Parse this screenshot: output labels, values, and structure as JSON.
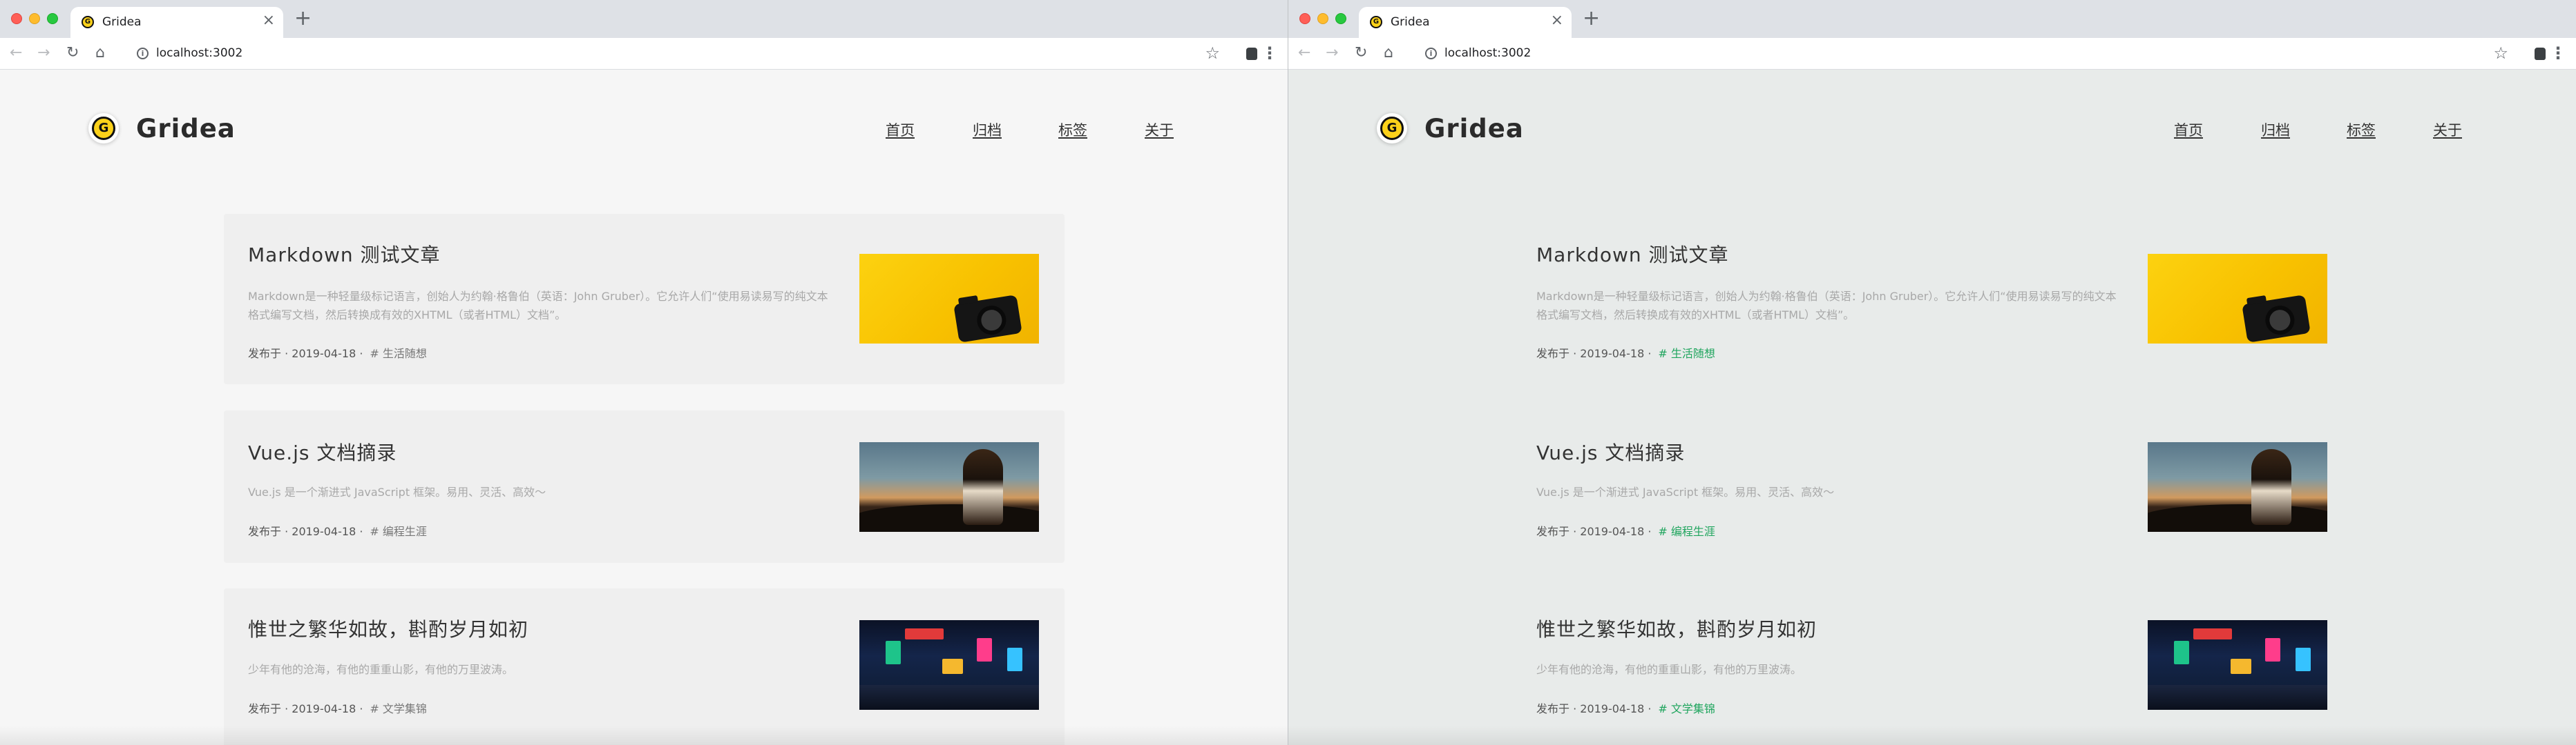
{
  "browser": {
    "tab_title": "Gridea",
    "url": "localhost:3002",
    "new_tab_symbol": "+",
    "close_symbol": "×"
  },
  "site": {
    "title": "Gridea",
    "logo_letter": "G",
    "menu": [
      "首页",
      "归档",
      "标签",
      "关于"
    ]
  },
  "posts": [
    {
      "title": "Markdown 测试文章",
      "abstract": "Markdown是一种轻量级标记语言，创始人为约翰·格鲁伯（英语：John Gruber）。它允许人们“使用易读易写的纯文本格式编写文档，然后转换成有效的XHTML（或者HTML）文档”。",
      "meta": "发布于 · 2019-04-18 ·",
      "tag": "# 生活随想",
      "image": "yellow-camera"
    },
    {
      "title": "Vue.js 文档摘录",
      "abstract": "Vue.js 是一个渐进式 JavaScript 框架。易用、灵活、高效～",
      "meta": "发布于 · 2019-04-18 ·",
      "tag": "# 编程生涯",
      "image": "mountain-portrait"
    },
    {
      "title": "惟世之繁华如故，斟酌岁月如初",
      "abstract": "少年有他的沧海，有他的重重山影，有他的万里波涛。",
      "meta": "发布于 · 2019-04-18 ·",
      "tag": "# 文学集锦",
      "image": "neon-night-street"
    }
  ],
  "colors": {
    "left_background": "#f6f6f6",
    "right_background": "#e8ebea",
    "right_tag_accent": "#20a55e",
    "logo_yellow": "#fbd11a"
  },
  "icons": [
    "back-arrow-icon",
    "forward-arrow-icon",
    "reload-icon",
    "home-icon",
    "info-icon",
    "star-icon",
    "extension-icon",
    "menu-dots-icon"
  ]
}
